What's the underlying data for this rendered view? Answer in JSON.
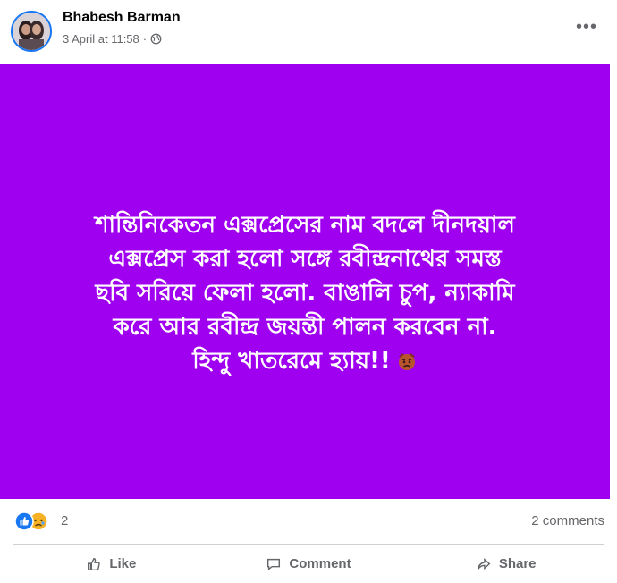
{
  "post": {
    "author": "Bhabesh Barman",
    "timestamp": "3 April at 11:58",
    "separator": "·",
    "privacy_icon": "globe-icon",
    "more_label": "•••",
    "card": {
      "background": "#a000f0",
      "text": "শান্তিনিকেতন এক্সপ্রেসের নাম বদলে দীনদয়াল\nএক্সপ্রেস করা হলো সঙ্গে রবীন্দ্রনাথের সমস্ত\nছবি সরিয়ে ফেলা হলো. বাঙালি চুপ, ন্যাকামি\nকরে আর রবীন্দ্র জয়ন্তী পালন করবেন না.\nহিন্দু খাতরেমে হ্যায়!!",
      "emoji_icon": "angry-face-icon"
    },
    "reactions": {
      "icons": [
        "like-icon",
        "sad-icon"
      ],
      "count": "2",
      "comments": "2 comments"
    },
    "actions": [
      {
        "label": "Like",
        "icon": "thumbs-up-icon"
      },
      {
        "label": "Comment",
        "icon": "comment-icon"
      },
      {
        "label": "Share",
        "icon": "share-icon"
      }
    ]
  }
}
